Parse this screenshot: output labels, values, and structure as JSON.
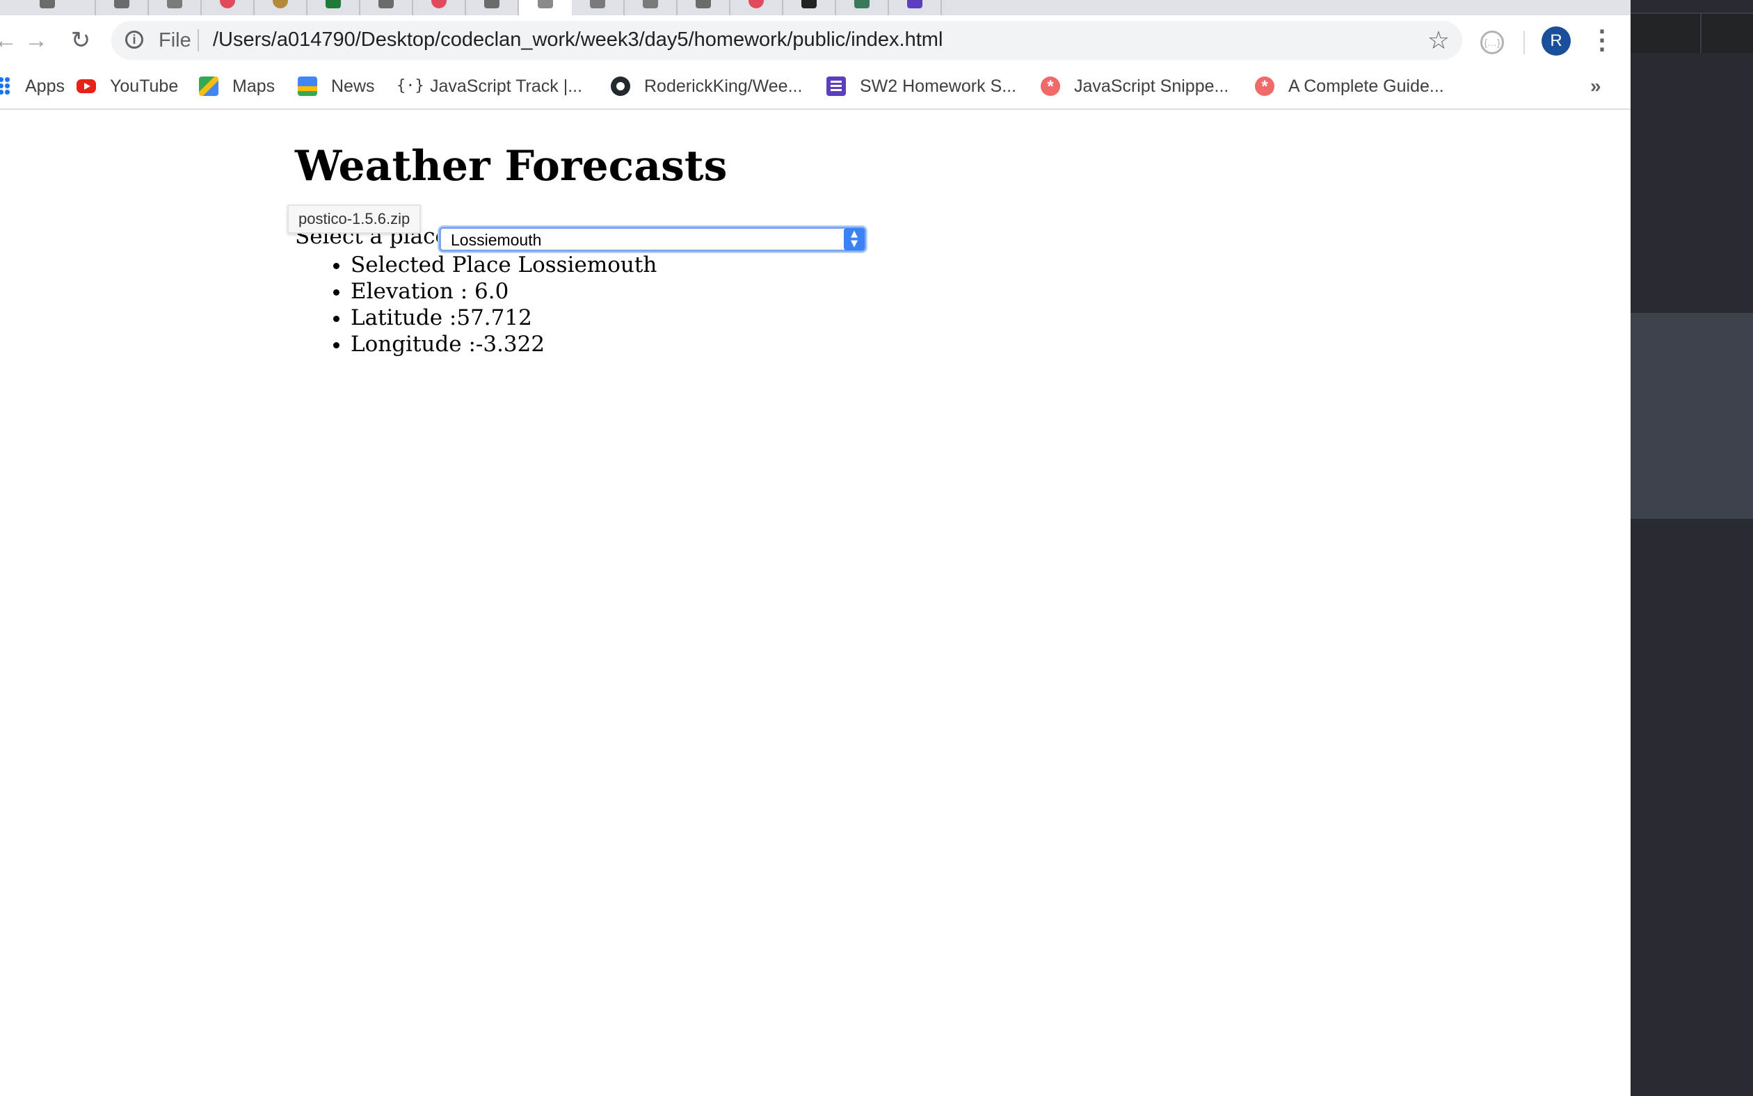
{
  "browser": {
    "url_scheme": "File",
    "url": "/Users/a014790/Desktop/codeclan_work/week3/day5/homework/public/index.html",
    "profile_initial": "R",
    "tab_count": 17
  },
  "bookmarks": [
    {
      "label": "Apps",
      "icon": "apps-grid-icon"
    },
    {
      "label": "YouTube",
      "icon": "youtube-icon"
    },
    {
      "label": "Maps",
      "icon": "maps-icon"
    },
    {
      "label": "News",
      "icon": "news-icon"
    },
    {
      "label": "JavaScript Track |...",
      "icon": "code-braces-icon"
    },
    {
      "label": "RoderickKing/Wee...",
      "icon": "github-icon"
    },
    {
      "label": "SW2 Homework S...",
      "icon": "list-icon"
    },
    {
      "label": "JavaScript Snippe...",
      "icon": "asterisk-icon"
    },
    {
      "label": "A Complete Guide...",
      "icon": "asterisk-icon"
    }
  ],
  "page": {
    "title": "Weather Forecasts",
    "tooltip": "postico-1.5.6.zip",
    "select_label": "Select a place:",
    "selected_place": "Lossiemouth",
    "details": [
      "Selected Place Lossiemouth",
      "Elevation : 6.0",
      "Latitude :57.712",
      "Longitude :-3.322"
    ]
  },
  "colors": {
    "select_accent": "#3b82f6",
    "avatar_bg": "#1a4f9c",
    "dark_panel": "#282b31"
  }
}
